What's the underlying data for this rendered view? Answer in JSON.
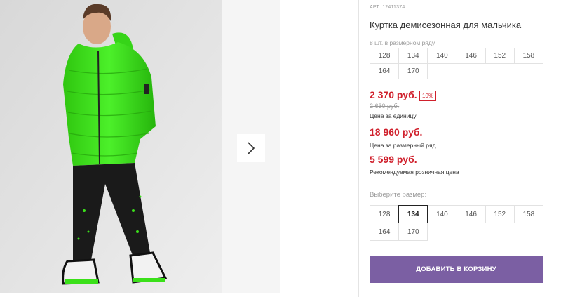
{
  "gallery": {
    "next_icon": "chevron-right-icon",
    "photo_alt": "product-photo"
  },
  "product": {
    "article": "АРТ: 12411374",
    "title": "Куртка демисезонная для мальчика",
    "pack_note": "8 шт. в размерном ряду",
    "pack_sizes": [
      "128",
      "134",
      "140",
      "146",
      "152",
      "158",
      "164",
      "170"
    ],
    "price_unit": "2 370 руб.",
    "discount": "10%",
    "price_old": "2 630 руб.",
    "price_unit_caption": "Цена за единицу",
    "price_pack": "18 960 руб.",
    "price_pack_caption": "Цена за размерный ряд",
    "price_rrp": "5 599 руб.",
    "price_rrp_caption": "Рекомендуемая розничная цена",
    "choose_size_label": "Выберите размер:",
    "select_sizes": [
      "128",
      "134",
      "140",
      "146",
      "152",
      "158",
      "164",
      "170"
    ],
    "selected_size": "134",
    "add_to_cart": "ДОБАВИТЬ В КОРЗИНУ"
  },
  "colors": {
    "price_red": "#d0202c",
    "button_purple": "#7b5fa3",
    "jacket_green": "#3be01a"
  }
}
